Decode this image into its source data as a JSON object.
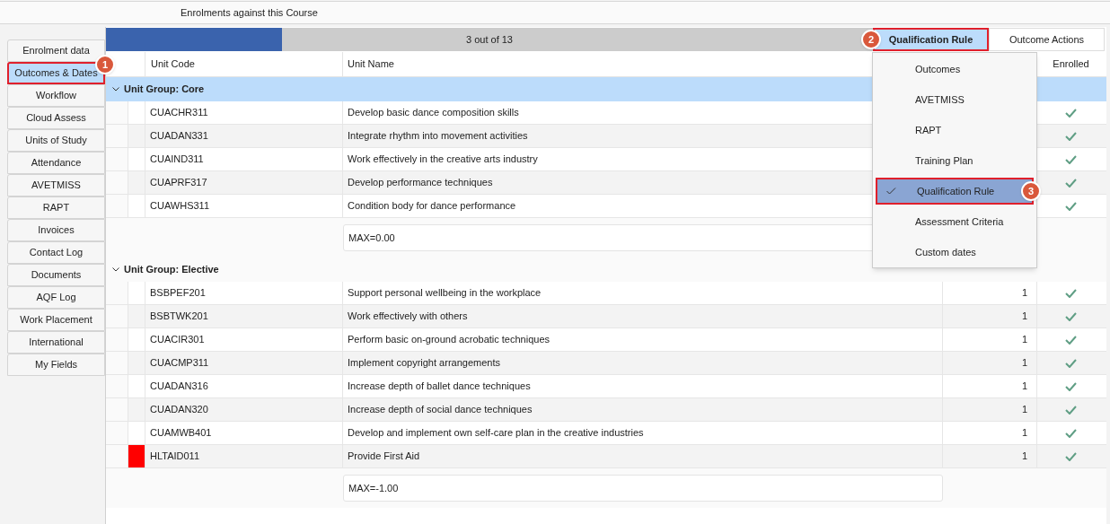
{
  "header": {
    "title": "Enrolments against this Course"
  },
  "sidebar": {
    "items": [
      {
        "label": "Enrolment data",
        "selected": false
      },
      {
        "label": "Outcomes & Dates",
        "selected": true,
        "highlighted": true,
        "badge": "1"
      },
      {
        "label": "Workflow",
        "selected": false
      },
      {
        "label": "Cloud Assess",
        "selected": false
      },
      {
        "label": "Units of Study",
        "selected": false
      },
      {
        "label": "Attendance",
        "selected": false
      },
      {
        "label": "AVETMISS",
        "selected": false
      },
      {
        "label": "RAPT",
        "selected": false
      },
      {
        "label": "Invoices",
        "selected": false
      },
      {
        "label": "Contact Log",
        "selected": false
      },
      {
        "label": "Documents",
        "selected": false
      },
      {
        "label": "AQF Log",
        "selected": false
      },
      {
        "label": "Work Placement",
        "selected": false
      },
      {
        "label": "International",
        "selected": false
      },
      {
        "label": "My Fields",
        "selected": false
      }
    ]
  },
  "progress": {
    "level": 0.23,
    "label": "3 out of 13"
  },
  "view_buttons": [
    {
      "label": "Qualification Rule",
      "selected": true,
      "highlighted": true,
      "badge": "2"
    },
    {
      "label": "Outcome Actions",
      "selected": false,
      "highlighted": false
    }
  ],
  "table": {
    "columns": [
      "Unit Code",
      "Unit Name",
      "Enrolled"
    ],
    "groups": [
      {
        "title": "Unit Group: Core",
        "selected": true,
        "rows": [
          {
            "code": "CUACHR311",
            "name": "Develop basic dance composition skills",
            "enrolled": true,
            "flagged": false
          },
          {
            "code": "CUADAN331",
            "name": "Integrate rhythm into movement activities",
            "enrolled": true,
            "flagged": false
          },
          {
            "code": "CUAIND311",
            "name": "Work effectively in the creative arts industry",
            "enrolled": true,
            "flagged": false
          },
          {
            "code": "CUAPRF317",
            "name": "Develop performance techniques",
            "enrolled": true,
            "flagged": false
          },
          {
            "code": "CUAWHS311",
            "name": "Condition body for dance performance",
            "enrolled": true,
            "flagged": false
          }
        ],
        "rule": "MAX=0.00"
      },
      {
        "title": "Unit Group: Elective",
        "selected": false,
        "rows": [
          {
            "code": "BSBPEF201",
            "name": "Support personal wellbeing in the workplace",
            "count": "1",
            "enrolled": true,
            "flagged": false
          },
          {
            "code": "BSBTWK201",
            "name": "Work effectively with others",
            "count": "1",
            "enrolled": true,
            "flagged": false
          },
          {
            "code": "CUACIR301",
            "name": "Perform basic on-ground acrobatic techniques",
            "count": "1",
            "enrolled": true,
            "flagged": false
          },
          {
            "code": "CUACMP311",
            "name": "Implement copyright arrangements",
            "count": "1",
            "enrolled": true,
            "flagged": false
          },
          {
            "code": "CUADAN316",
            "name": "Increase depth of ballet dance techniques",
            "count": "1",
            "enrolled": true,
            "flagged": false
          },
          {
            "code": "CUADAN320",
            "name": "Increase depth of social dance techniques",
            "count": "1",
            "enrolled": true,
            "flagged": false
          },
          {
            "code": "CUAMWB401",
            "name": "Develop and implement own self-care plan in the creative industries",
            "count": "1",
            "enrolled": true,
            "flagged": false
          },
          {
            "code": "HLTAID011",
            "name": "Provide First Aid",
            "count": "1",
            "enrolled": true,
            "flagged": true
          }
        ],
        "rule": "MAX=-1.00"
      }
    ]
  },
  "view_menu": {
    "items": [
      {
        "label": "Outcomes",
        "checked": false,
        "highlighted": false
      },
      {
        "label": "AVETMISS",
        "checked": false,
        "highlighted": false
      },
      {
        "label": "RAPT",
        "checked": false,
        "highlighted": false
      },
      {
        "label": "Training Plan",
        "checked": false,
        "highlighted": false
      },
      {
        "label": "Qualification Rule",
        "checked": true,
        "highlighted": true,
        "badge": "3"
      },
      {
        "label": "Assessment Criteria",
        "checked": false,
        "highlighted": false
      },
      {
        "label": "Custom dates",
        "checked": false,
        "highlighted": false
      }
    ]
  }
}
